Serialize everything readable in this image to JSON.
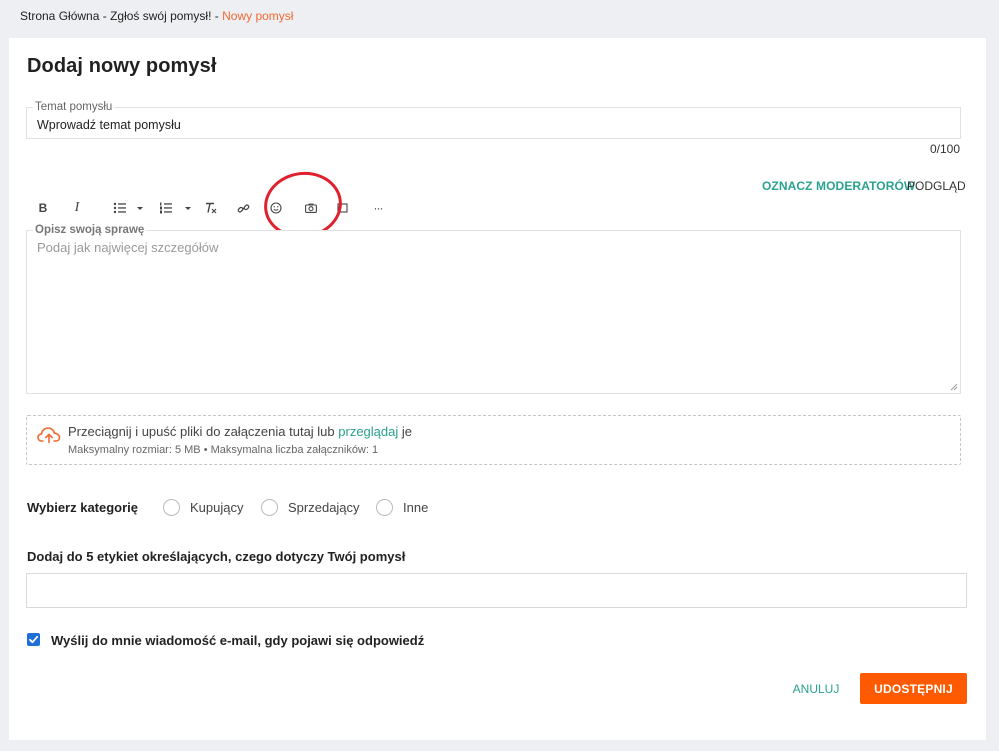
{
  "breadcrumb": {
    "home": "Strona Główna",
    "separator": " - ",
    "parent": "Zgłoś swój pomysł!",
    "current": "Nowy pomysł"
  },
  "page": {
    "title": "Dodaj nowy pomysł"
  },
  "topic": {
    "label": "Temat pomysłu",
    "value": "Wprowadź temat pomysłu",
    "counter": "0/100"
  },
  "editor": {
    "tag_moderators": "OZNACZ MODERATORÓW",
    "preview": "PODGLĄD",
    "toolbar": {
      "bold": "B",
      "italic": "I",
      "more": "···"
    },
    "label": "Opisz swoją sprawę",
    "placeholder": "Podaj jak najwięcej szczegółów"
  },
  "attachments": {
    "text_before": "Przeciągnij i upuść pliki do załączenia tutaj lub ",
    "link": "przeglądaj",
    "text_after": " je",
    "limits": "Maksymalny rozmiar: 5 MB • Maksymalna liczba załączników: 1"
  },
  "category": {
    "label": "Wybierz kategorię",
    "options": [
      "Kupujący",
      "Sprzedający",
      "Inne"
    ]
  },
  "tags": {
    "label": "Dodaj do 5 etykiet określających, czego dotyczy Twój pomysł",
    "value": ""
  },
  "email_notify": {
    "label": "Wyślij do mnie wiadomość e-mail, gdy pojawi się odpowiedź",
    "checked": true
  },
  "actions": {
    "cancel": "ANULUJ",
    "submit": "UDOSTĘPNIJ"
  },
  "colors": {
    "accent_teal": "#2aa28e",
    "primary_orange": "#ff5a00",
    "breadcrumb_current": "#f06a35",
    "annotation_red": "#e0202c"
  }
}
